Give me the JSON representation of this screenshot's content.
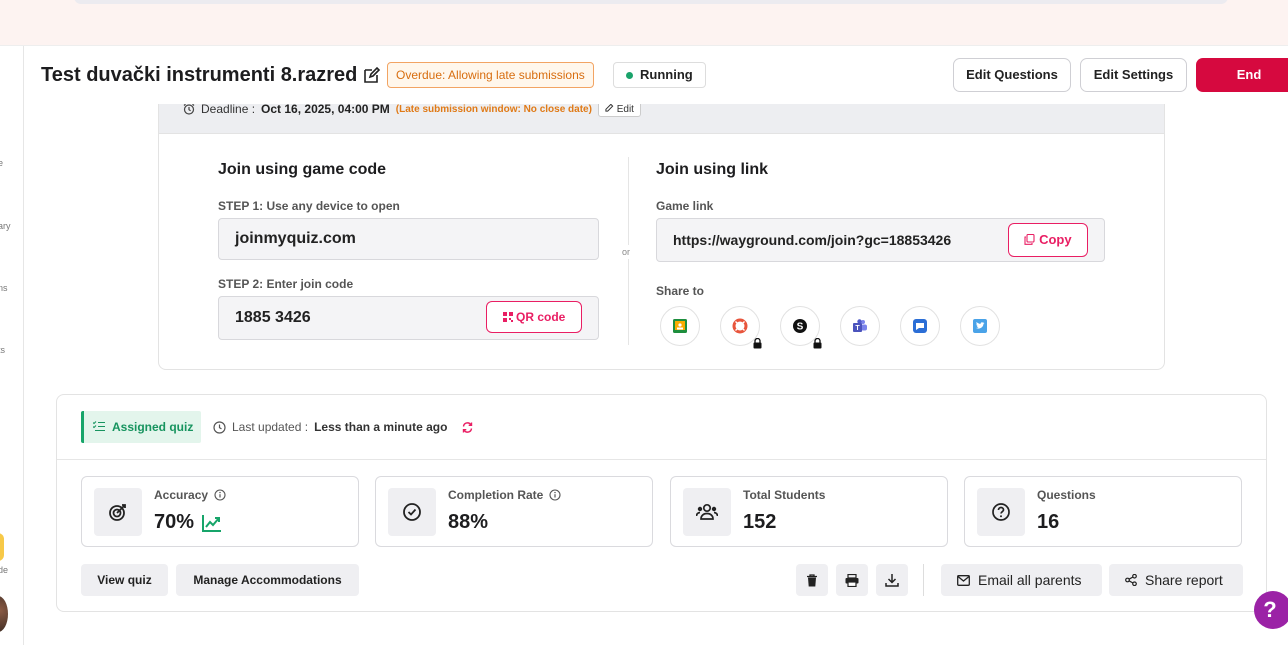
{
  "header": {
    "title": "Test duvački instrumenti 8.razred",
    "overdue_badge": "Overdue: Allowing late submissions",
    "status": "Running",
    "edit_questions": "Edit Questions",
    "edit_settings": "Edit Settings",
    "end": "End"
  },
  "sidebar": {
    "fragments": [
      "e",
      "ary",
      "ns",
      "ts",
      "de"
    ]
  },
  "deadline": {
    "label": "Deadline :",
    "value": "Oct 16, 2025, 04:00 PM",
    "late_note": "(Late submission window: No close date)",
    "edit": "Edit"
  },
  "join_code": {
    "title": "Join using game code",
    "step1": "STEP 1: Use any device to open",
    "site": "joinmyquiz.com",
    "step2": "STEP 2: Enter join code",
    "code": "1885 3426",
    "qr_button": "QR code"
  },
  "or_label": "or",
  "join_link": {
    "title": "Join using link",
    "link_label": "Game link",
    "link": "https://wayground.com/join?gc=18853426",
    "copy_button": "Copy",
    "share_label": "Share to",
    "share_targets": [
      "google-classroom-icon",
      "lifering-icon",
      "schoology-icon",
      "teams-icon",
      "remind-icon",
      "twitter-icon"
    ]
  },
  "report": {
    "assigned": "Assigned quiz",
    "last_updated_label": "Last updated :",
    "last_updated_value": "Less than a minute ago",
    "stats": [
      {
        "label": "Accuracy",
        "value": "70%"
      },
      {
        "label": "Completion Rate",
        "value": "88%"
      },
      {
        "label": "Total Students",
        "value": "152"
      },
      {
        "label": "Questions",
        "value": "16"
      }
    ],
    "view_quiz": "View quiz",
    "manage_accommodations": "Manage Accommodations",
    "email_parents": "Email all parents",
    "share_report": "Share report"
  },
  "help": "?",
  "colors": {
    "accent": "#e91e63",
    "end": "#d6093f",
    "success": "#17a56a",
    "overdue": "#d86e10",
    "help": "#9b22a6"
  }
}
